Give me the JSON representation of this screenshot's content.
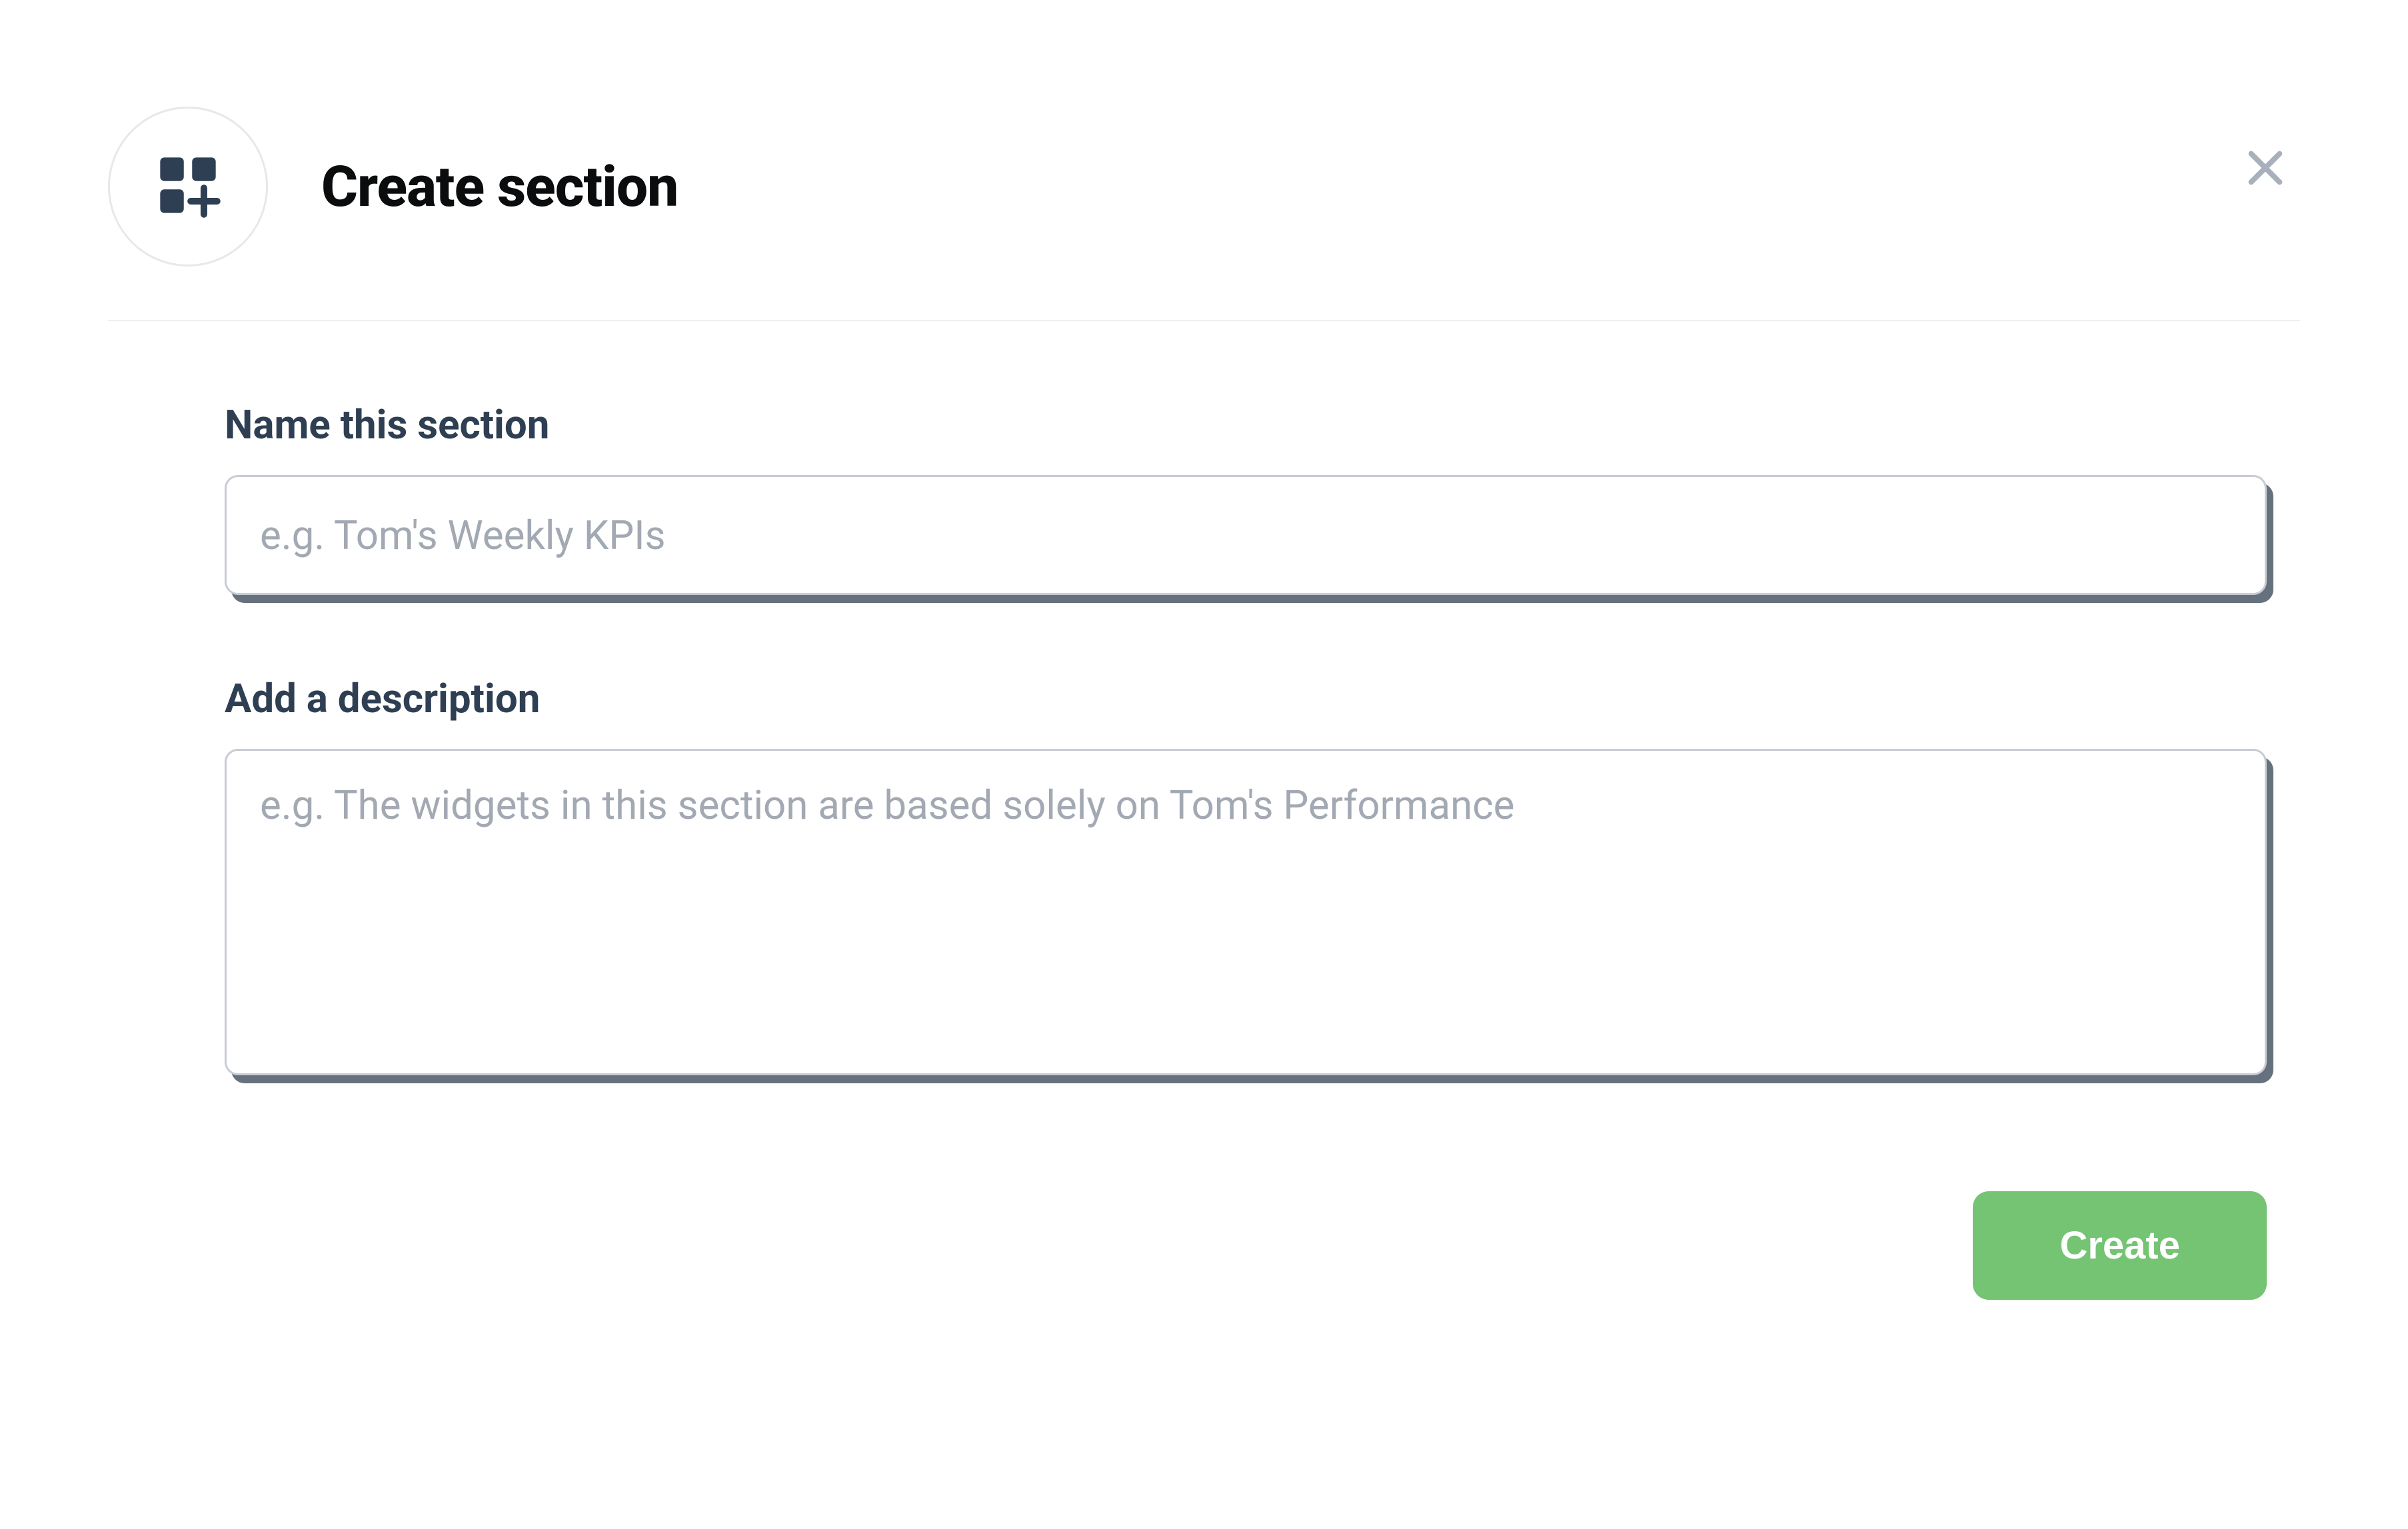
{
  "dialog": {
    "title": "Create section",
    "close_label": "Close"
  },
  "form": {
    "name_label": "Name this section",
    "name_value": "",
    "name_placeholder": "e.g. Tom's Weekly KPIs",
    "description_label": "Add a description",
    "description_value": "",
    "description_placeholder": "e.g. The widgets in this section are based solely on Tom's Performance"
  },
  "footer": {
    "create_label": "Create"
  }
}
